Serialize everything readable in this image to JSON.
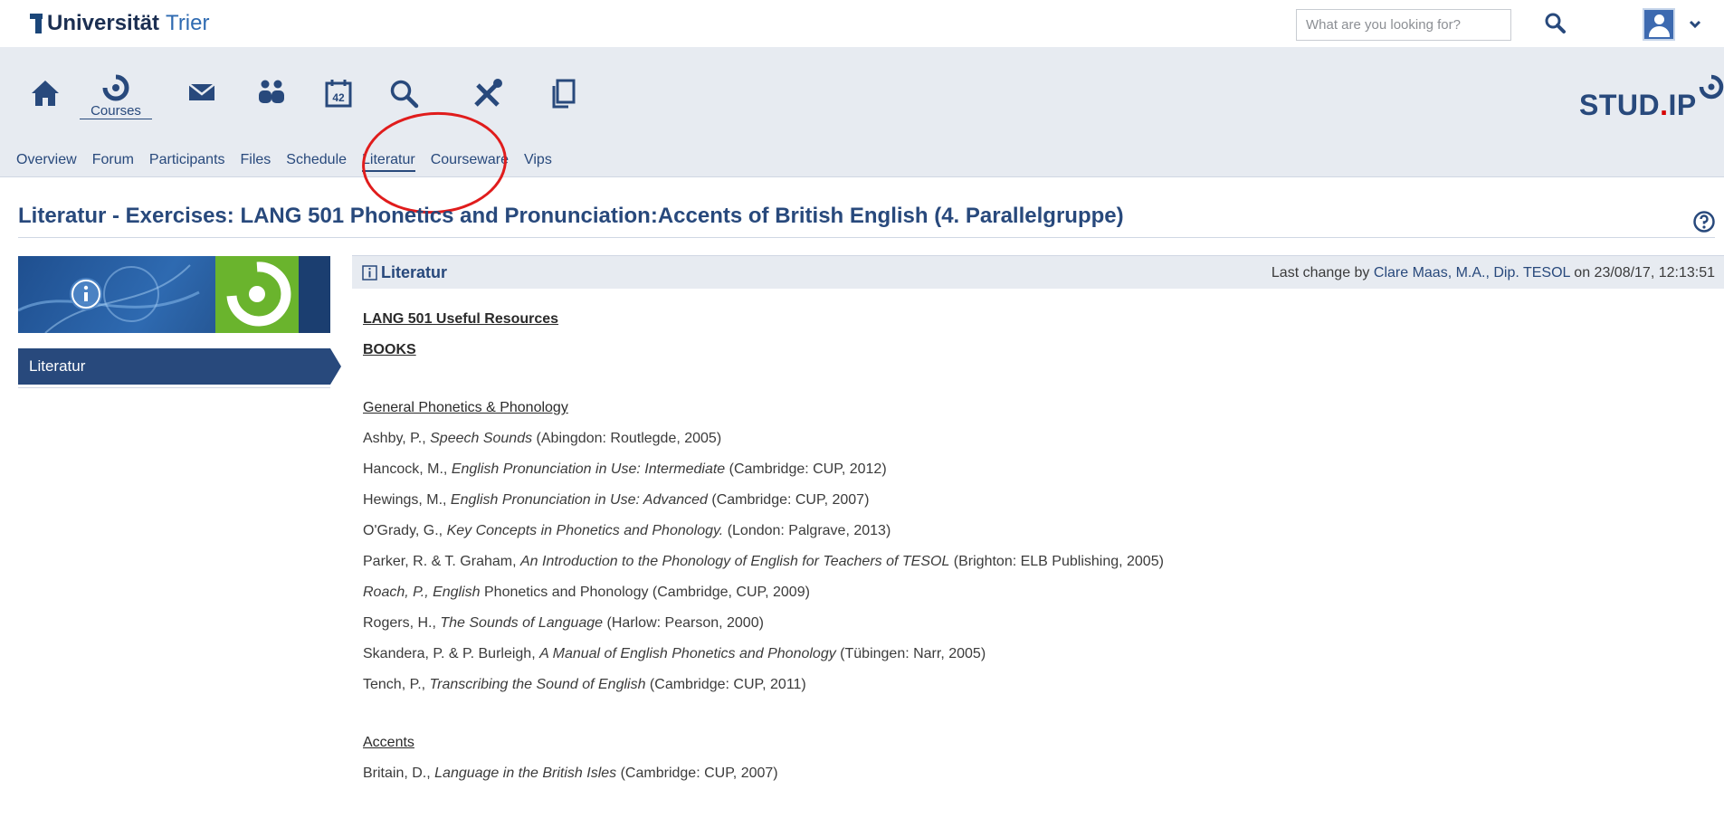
{
  "brand": {
    "name_bold": "Universität",
    "name_light": "Trier"
  },
  "search": {
    "placeholder": "What are you looking for?"
  },
  "icons": {
    "home": "home-icon",
    "courses": "courses-icon",
    "messages": "mail-icon",
    "community": "community-icon",
    "calendar": "calendar-icon",
    "search": "search-icon",
    "tools": "tools-icon",
    "files": "files-icon",
    "help": "help-icon",
    "avatar": "user-avatar-icon"
  },
  "nav": {
    "courses_label": "Courses",
    "calendar_day": "42",
    "studip_logo": {
      "text": "STUD",
      "dot": ".",
      "suffix": "IP"
    }
  },
  "tabs": [
    {
      "label": "Overview"
    },
    {
      "label": "Forum"
    },
    {
      "label": "Participants"
    },
    {
      "label": "Files"
    },
    {
      "label": "Schedule"
    },
    {
      "label": "Literatur",
      "active": true
    },
    {
      "label": "Courseware"
    },
    {
      "label": "Vips"
    }
  ],
  "page": {
    "title": "Literatur - Exercises: LANG 501 Phonetics and Pronunciation:Accents of British English (4. Parallelgruppe)"
  },
  "sidebar": {
    "items": [
      {
        "label": "Literatur",
        "active": true
      }
    ]
  },
  "content": {
    "header_title": "Literatur",
    "last_change_prefix": "Last change by",
    "last_change_author": "Clare Maas, M.A., Dip. TESOL",
    "last_change_on": "on",
    "last_change_date": "23/08/17, 12:13:51",
    "heading_resources": "LANG 501 Useful Resources",
    "heading_books": "BOOKS",
    "section_general": "General Phonetics & Phonology",
    "general": [
      {
        "pre": "Ashby, P., ",
        "italic": "Speech Sounds",
        "post": " (Abingdon: Routlegde, 2005)"
      },
      {
        "pre": "Hancock, M., ",
        "italic": "English Pronunciation in Use: Intermediate",
        "post": " (Cambridge: CUP, 2012)"
      },
      {
        "pre": "Hewings, M., ",
        "italic": "English Pronunciation in Use: Advanced",
        "post": " (Cambridge: CUP, 2007)"
      },
      {
        "pre": "O'Grady, G., ",
        "italic": "Key Concepts in Phonetics and Phonology.",
        "post": " (London: Palgrave, 2013)"
      },
      {
        "pre": "Parker, R. & T. Graham, ",
        "italic": "An Introduction to the Phonology of English for Teachers of TESOL",
        "post": " (Brighton: ELB Publishing, 2005)"
      },
      {
        "pre": "",
        "italic": "Roach, P., English",
        "post": " Phonetics and Phonology (Cambridge, CUP, 2009)"
      },
      {
        "pre": "Rogers, H., ",
        "italic": "The Sounds of Language",
        "post": " (Harlow: Pearson, 2000)"
      },
      {
        "pre": "Skandera, P. & P. Burleigh, ",
        "italic": "A Manual of English Phonetics and Phonology",
        "post": " (Tübingen: Narr, 2005)"
      },
      {
        "pre": "Tench, P., ",
        "italic": "Transcribing the Sound of English",
        "post": " (Cambridge: CUP, 2011)"
      }
    ],
    "section_accents": "Accents",
    "accents": [
      {
        "pre": "Britain, D., ",
        "italic": "Language in the British Isles",
        "post": " (Cambridge: CUP, 2007)"
      }
    ]
  },
  "colors": {
    "brand_blue": "#28497c",
    "nav_bg": "#e7ebf1",
    "annotation": "#e01c1c",
    "studip_green": "#6ab42d"
  }
}
